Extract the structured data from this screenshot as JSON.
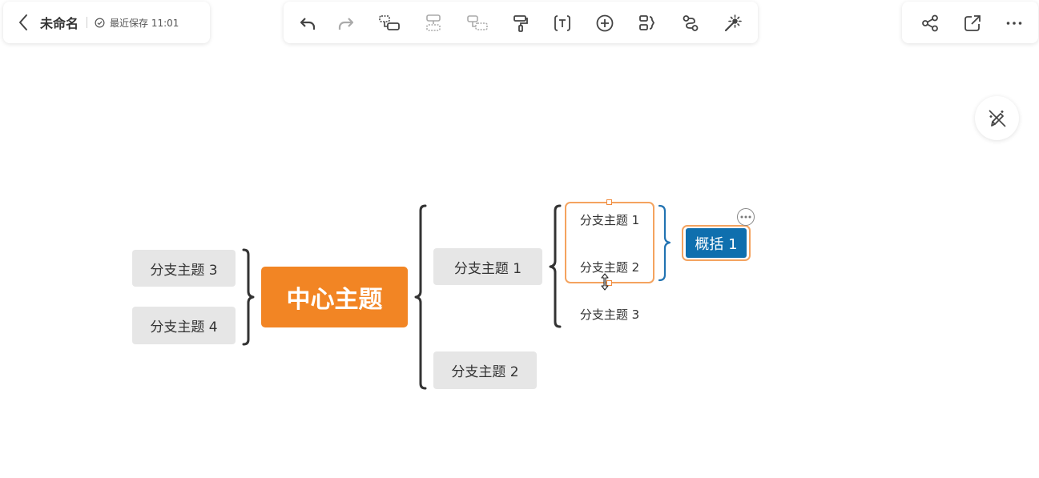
{
  "header": {
    "title": "未命名",
    "save_status": "最近保存 11:01"
  },
  "toolbar": {
    "buttons": [
      {
        "name": "undo",
        "icon": "undo-icon"
      },
      {
        "name": "redo",
        "icon": "redo-icon"
      },
      {
        "name": "insert-child-topic",
        "icon": "child-topic-icon"
      },
      {
        "name": "insert-sibling-topic",
        "icon": "sibling-topic-icon"
      },
      {
        "name": "insert-parent-topic",
        "icon": "parent-topic-icon"
      },
      {
        "name": "format-painter",
        "icon": "format-painter-icon"
      },
      {
        "name": "text",
        "icon": "text-icon"
      },
      {
        "name": "insert",
        "icon": "plus-circle-icon"
      },
      {
        "name": "summary",
        "icon": "summary-icon"
      },
      {
        "name": "relationship",
        "icon": "relationship-icon"
      },
      {
        "name": "magic",
        "icon": "magic-wand-icon"
      }
    ]
  },
  "right_toolbar": {
    "buttons": [
      {
        "name": "share",
        "icon": "share-icon"
      },
      {
        "name": "open-external",
        "icon": "external-link-icon"
      },
      {
        "name": "more",
        "icon": "more-horizontal-icon"
      }
    ]
  },
  "mindmap": {
    "root": "中心主题",
    "right_branches": [
      "分支主题 1",
      "分支主题 2"
    ],
    "left_branches": [
      "分支主题 3",
      "分支主题 4"
    ],
    "subtopics": [
      "分支主题 1",
      "分支主题 2",
      "分支主题 3"
    ],
    "summary": "概括 1"
  },
  "colors": {
    "root": "#f28524",
    "summary": "#0f6fae",
    "selection": "#f4a35f",
    "branch_fill": "#e6e6e6",
    "bracket": "#333333"
  }
}
